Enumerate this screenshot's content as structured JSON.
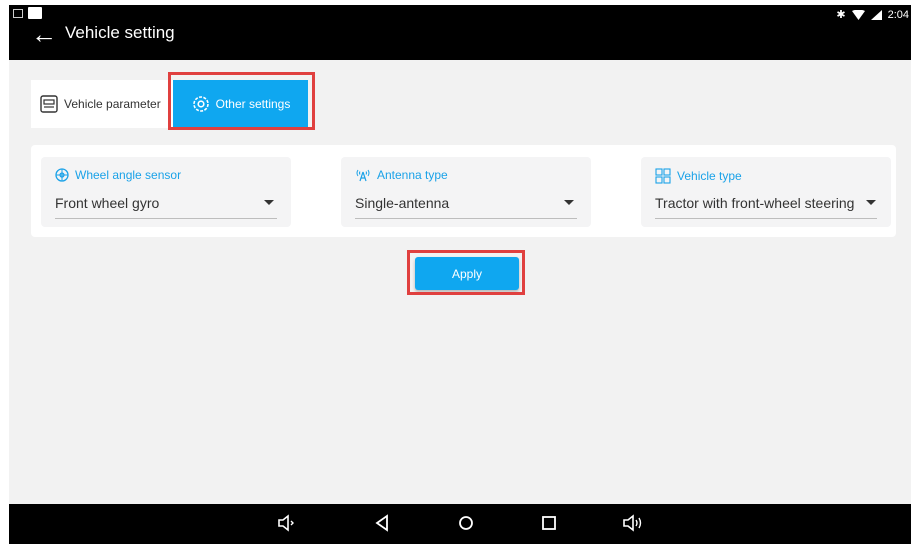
{
  "statusbar": {
    "time": "2:04",
    "icons": [
      "bluetooth-icon",
      "wifi-icon",
      "signal-icon"
    ]
  },
  "header": {
    "title": "Vehicle setting",
    "back_icon": "back-arrow-icon"
  },
  "tabs": [
    {
      "label": "Vehicle parameter",
      "icon": "vehicle-icon",
      "active": false
    },
    {
      "label": "Other settings",
      "icon": "gear-icon",
      "active": true
    }
  ],
  "fields": {
    "wheel_angle_sensor": {
      "label": "Wheel angle sensor",
      "value": "Front wheel gyro",
      "icon": "wheel-icon"
    },
    "antenna_type": {
      "label": "Antenna type",
      "value": "Single-antenna",
      "icon": "antenna-icon"
    },
    "vehicle_type": {
      "label": "Vehicle type",
      "value": "Tractor with front-wheel steering",
      "icon": "vehicle-type-icon"
    }
  },
  "apply": {
    "label": "Apply"
  },
  "navbar": {
    "icons": [
      "volume-down-icon",
      "back-icon",
      "home-icon",
      "recents-icon",
      "volume-up-icon"
    ]
  },
  "colors": {
    "accent": "#0fa7f0",
    "highlight": "#e0403f",
    "label": "#1aa2e8"
  }
}
